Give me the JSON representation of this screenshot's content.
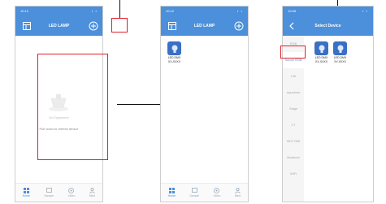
{
  "colors": {
    "accent": "#4c8fda",
    "highlight": "#e0202a"
  },
  "screen1": {
    "status_time": "10:12",
    "title": "LED LAMP",
    "empty_title": "No Equipment",
    "empty_hint": "Pull down to refresh device",
    "tabs": [
      "Home",
      "Sample",
      "Video",
      "Mine"
    ]
  },
  "screen2": {
    "status_time": "10:12",
    "title": "LED LAMP",
    "device_label": "LED DMX",
    "device_id": "XX-XXXX",
    "tabs": [
      "Home",
      "Sample",
      "Video",
      "Mine"
    ]
  },
  "screen3": {
    "status_time": "10:08",
    "title": "Select Device",
    "categories": [
      "RGB",
      "Seccle RGB",
      "CW",
      "Aquarium",
      "Stage",
      "CT",
      "WHT DMI",
      "Breakout",
      "WIFI"
    ],
    "devices": [
      {
        "label": "LED DMX",
        "id": "XX-XXXX"
      },
      {
        "label": "LED DMX",
        "id": "XY-XXXX"
      }
    ]
  }
}
